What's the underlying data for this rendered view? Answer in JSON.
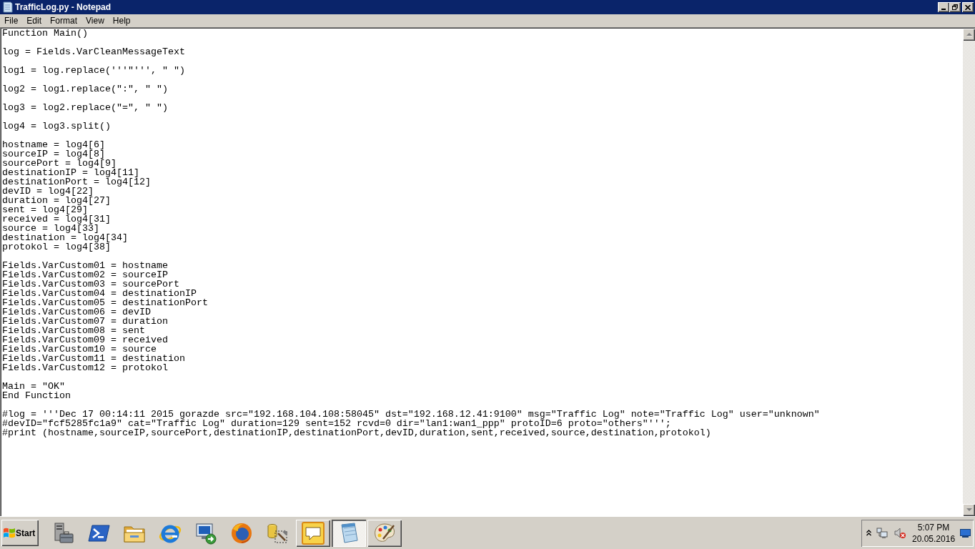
{
  "window": {
    "title": "TrafficLog.py - Notepad"
  },
  "menu_bar": {
    "items": [
      "File",
      "Edit",
      "Format",
      "View",
      "Help"
    ]
  },
  "editor": {
    "blocks": [
      [
        "Function Main()"
      ],
      [
        "log = Fields.VarCleanMessageText"
      ],
      [
        "log1 = log.replace('''\"''', \" \")"
      ],
      [
        "log2 = log1.replace(\":\", \" \")"
      ],
      [
        "log3 = log2.replace(\"=\", \" \")"
      ],
      [
        "log4 = log3.split()"
      ],
      [
        "hostname = log4[6]",
        "sourceIP = log4[8]",
        "sourcePort = log4[9]",
        "destinationIP = log4[11]",
        "destinationPort = log4[12]",
        "devID = log4[22]",
        "duration = log4[27]",
        "sent = log4[29]",
        "received = log4[31]",
        "source = log4[33]",
        "destination = log4[34]",
        "protokol = log4[38]"
      ],
      [
        "Fields.VarCustom01 = hostname",
        "Fields.VarCustom02 = sourceIP",
        "Fields.VarCustom03 = sourcePort",
        "Fields.VarCustom04 = destinationIP",
        "Fields.VarCustom05 = destinationPort",
        "Fields.VarCustom06 = devID",
        "Fields.VarCustom07 = duration",
        "Fields.VarCustom08 = sent",
        "Fields.VarCustom09 = received",
        "Fields.VarCustom10 = source",
        "Fields.VarCustom11 = destination",
        "Fields.VarCustom12 = protokol"
      ],
      [
        "Main = \"OK\"",
        "End Function"
      ],
      [
        "#log = '''Dec 17 00:14:11 2015 gorazde src=\"192.168.104.108:58045\" dst=\"192.168.12.41:9100\" msg=\"Traffic Log\" note=\"Traffic Log\" user=\"unknown\"",
        "#devID=\"fcf5285fc1a9\" cat=\"Traffic Log\" duration=129 sent=152 rcvd=0 dir=\"lan1:wan1_ppp\" protoID=6 proto=\"others\"''';",
        "#print (hostname,sourceIP,sourcePort,destinationIP,destinationPort,devID,duration,sent,received,source,destination,protokol)"
      ]
    ]
  },
  "taskbar": {
    "start_button": "Start",
    "apps": [
      {
        "running": false,
        "selected": false
      },
      {
        "running": false,
        "selected": false
      },
      {
        "running": false,
        "selected": false
      },
      {
        "running": false,
        "selected": false
      },
      {
        "running": false,
        "selected": false
      },
      {
        "running": false,
        "selected": false
      },
      {
        "running": false,
        "selected": false
      },
      {
        "running": true,
        "selected": false
      },
      {
        "running": true,
        "selected": true
      },
      {
        "running": true,
        "selected": false
      }
    ],
    "tray": {
      "volume_muted": true,
      "clock": {
        "time": "5:07 PM",
        "date": "20.05.2016"
      }
    }
  }
}
